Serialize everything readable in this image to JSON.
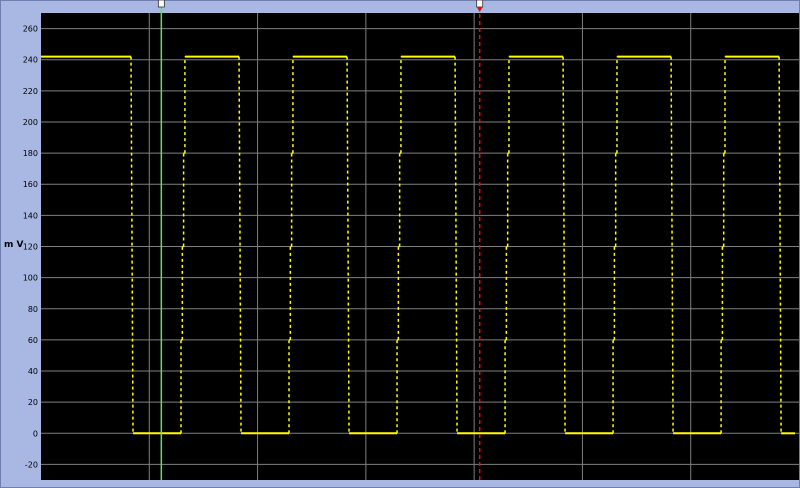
{
  "chart_data": {
    "type": "line",
    "ylabel": "m V",
    "ylim": [
      -30,
      270
    ],
    "yticks": [
      -20,
      0,
      20,
      40,
      60,
      80,
      100,
      120,
      140,
      160,
      180,
      200,
      220,
      240,
      260
    ],
    "grid": true,
    "background": "#000000",
    "line_color": "#ffff00",
    "grid_color": "#7f7f7f",
    "series": [
      {
        "segments": [
          {
            "high": [
              0.0,
              0.095
            ],
            "low": [
              0.095,
              0.152
            ]
          },
          {
            "high": [
              0.152,
              0.209
            ],
            "low": [
              0.209,
              0.266
            ]
          },
          {
            "high": [
              0.266,
              0.323
            ],
            "low": [
              0.323,
              0.38
            ]
          },
          {
            "high": [
              0.38,
              0.437
            ],
            "low": [
              0.437,
              0.494
            ]
          },
          {
            "high": [
              0.494,
              0.551
            ],
            "low": [
              0.551,
              0.608
            ]
          },
          {
            "high": [
              0.608,
              0.665
            ],
            "low": [
              0.665,
              0.722
            ]
          },
          {
            "high": [
              0.722,
              0.779
            ],
            "low": [
              0.779,
              0.8
            ]
          }
        ],
        "high_value": 242,
        "low_value": 0,
        "rise_steps": [
          60,
          120,
          180,
          242
        ]
      }
    ],
    "cursors": [
      {
        "color": "#66dd66",
        "style": "solid",
        "x": 0.127
      },
      {
        "color": "#dd1111",
        "style": "dashed",
        "x": 0.463
      }
    ]
  }
}
